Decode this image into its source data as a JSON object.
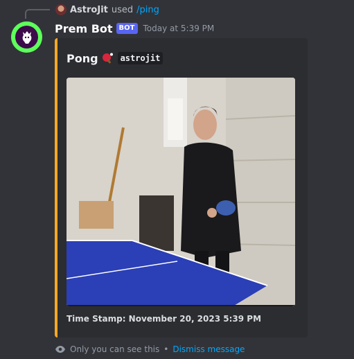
{
  "reply": {
    "username": "AstroJit",
    "used_text": "used",
    "command": "/ping"
  },
  "message": {
    "author": "Prem Bot",
    "bot_tag": "BOT",
    "timestamp": "Today at 5:39 PM"
  },
  "embed": {
    "title": "Pong",
    "title_icon": "ping-pong-paddle-icon",
    "mention": "astrojit",
    "image_alt": "gif-person-playing-ping-pong",
    "footer": "Time Stamp: November 20, 2023 5:39 PM",
    "accent_color": "#f9a825"
  },
  "ephemeral": {
    "icon": "eye-icon",
    "text": "Only you can see this",
    "separator": "•",
    "dismiss_label": "Dismiss message"
  },
  "colors": {
    "background": "#323339",
    "embed_background": "#2b2d31",
    "link": "#00a8fc",
    "bot_badge": "#5865f2",
    "avatar_ring": "#5dff5a"
  }
}
